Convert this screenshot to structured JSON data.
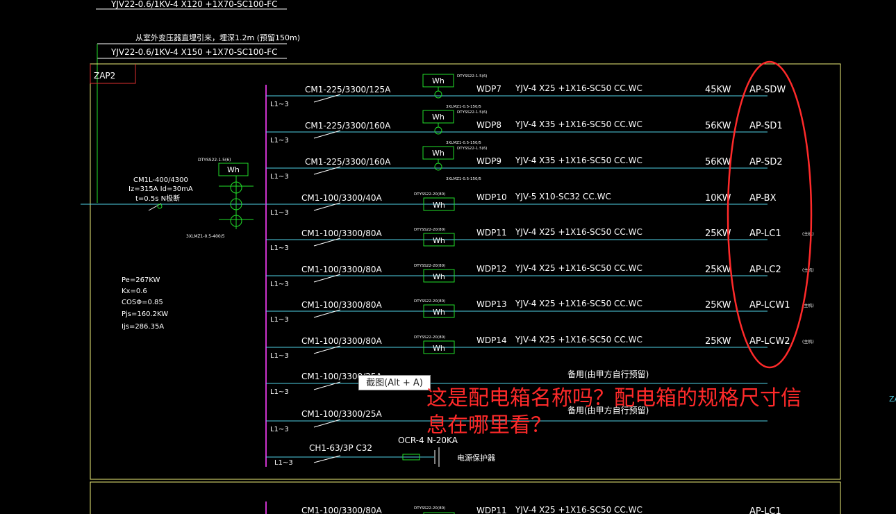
{
  "top_cable": "YJV22-0.6/1KV-4 X120 +1X70-SC100-FC",
  "feed_note": "从室外变压器直埋引来，埋深1.2m (预留150m)",
  "feed_cable": "YJV22-0.6/1KV-4 X150 +1X70-SC100-FC",
  "panel_name": "ZAP2",
  "edge_label": "ZA",
  "main_breaker": {
    "model": "CM1L-400/4300",
    "settings": "Iz=315A Id=30mA",
    "time": "t=0.5s N极断",
    "meter_tag": "DTYSS22-1.5(6)",
    "meter_label": "Wh",
    "ct_tag": "3XLMZ1-0.5-400/5"
  },
  "load_calc": [
    "Pe=267KW",
    "Kx=0.6",
    "COSΦ=0.85",
    "Pjs=160.2KW",
    "Ijs=286.35A"
  ],
  "phase_label": "L1~3",
  "circuits": [
    {
      "breaker": "CM1-225/3300/125A",
      "meter_tag": "DTYSS22-1.5(6)",
      "ct_tag": "",
      "meter": "Wh",
      "circuit": "WDP7",
      "cable": "YJV-4 X25 +1X16-SC50  CC.WC",
      "power": "45KW",
      "box": "AP-SDW",
      "note": ""
    },
    {
      "breaker": "CM1-225/3300/160A",
      "meter_tag": "DTYSS22-1.5(6)",
      "ct_tag": "3XLMZ1-0.5-150/5",
      "meter": "Wh",
      "circuit": "WDP8",
      "cable": "YJV-4 X35 +1X16-SC50  CC.WC",
      "power": "56KW",
      "box": "AP-SD1",
      "note": ""
    },
    {
      "breaker": "CM1-225/3300/160A",
      "meter_tag": "DTYSS22-1.5(6)",
      "ct_tag": "3XLMZ1-0.5-150/5",
      "meter": "Wh",
      "circuit": "WDP9",
      "cable": "YJV-4 X35 +1X16-SC50  CC.WC",
      "power": "56KW",
      "box": "AP-SD2",
      "note": ""
    },
    {
      "breaker": "CM1-100/3300/40A",
      "meter_tag": "DTYSS22-20(80)",
      "ct_tag": "3XLMZ1-0.5-150/5",
      "meter": "Wh",
      "circuit": "WDP10",
      "cable": "YJV-5 X10-SC32  CC.WC",
      "power": "10KW",
      "box": "AP-BX",
      "note": ""
    },
    {
      "breaker": "CM1-100/3300/80A",
      "meter_tag": "DTYSS22-20(80)",
      "ct_tag": "",
      "meter": "Wh",
      "circuit": "WDP11",
      "cable": "YJV-4 X25 +1X16-SC50  CC.WC",
      "power": "25KW",
      "box": "AP-LC1",
      "note": "(主机)"
    },
    {
      "breaker": "CM1-100/3300/80A",
      "meter_tag": "DTYSS22-20(80)",
      "ct_tag": "",
      "meter": "Wh",
      "circuit": "WDP12",
      "cable": "YJV-4 X25 +1X16-SC50  CC.WC",
      "power": "25KW",
      "box": "AP-LC2",
      "note": "(主机)"
    },
    {
      "breaker": "CM1-100/3300/80A",
      "meter_tag": "DTYSS22-20(80)",
      "ct_tag": "",
      "meter": "Wh",
      "circuit": "WDP13",
      "cable": "YJV-4 X25 +1X16-SC50  CC.WC",
      "power": "25KW",
      "box": "AP-LCW1",
      "note": "(主机)"
    },
    {
      "breaker": "CM1-100/3300/80A",
      "meter_tag": "DTYSS22-20(80)",
      "ct_tag": "",
      "meter": "Wh",
      "circuit": "WDP14",
      "cable": "YJV-4 X25 +1X16-SC50  CC.WC",
      "power": "25KW",
      "box": "AP-LCW2",
      "note": "(主机)"
    }
  ],
  "spares": [
    {
      "breaker": "CM1-100/3300/25A",
      "text": "备用(由甲方自行预留)"
    },
    {
      "breaker": "CM1-100/3300/25A",
      "text": "备用(由甲方自行预留)"
    }
  ],
  "spd": {
    "breaker": "CH1-63/3P C32",
    "model": "OCR-4 N-20KA",
    "text": "电源保护器"
  },
  "bottom_row": {
    "breaker": "CM1-100/3300/80A",
    "meter_tag": "DTYSS22-20(80)",
    "circuit": "WDP11",
    "cable": "YJV-4 X25 +1X16-SC50  CC.WC",
    "box": "AP-LC1"
  },
  "tooltip": "截图(Alt + A)",
  "question_lines": [
    "这是配电箱名称吗？配电箱的规格尺寸信",
    "息在哪里看？"
  ],
  "colors": {
    "background": "#000000",
    "cyan": "#4fd2e6",
    "green": "#22e02a",
    "magenta": "#cc33cc",
    "yellow": "#f0f07a",
    "red": "#ff2a2a",
    "white": "#ffffff"
  }
}
